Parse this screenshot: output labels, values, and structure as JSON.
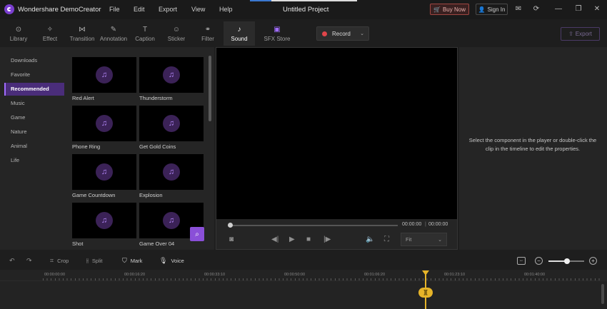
{
  "titlebar": {
    "app_name": "Wondershare DemoCreator",
    "menu": [
      "File",
      "Edit",
      "Export",
      "View",
      "Help"
    ],
    "project_title": "Untitled Project",
    "buy_now": "Buy Now",
    "sign_in": "Sign In"
  },
  "tabs": [
    {
      "label": "Library",
      "icon": "library-icon"
    },
    {
      "label": "Effect",
      "icon": "effect-icon"
    },
    {
      "label": "Transition",
      "icon": "transition-icon"
    },
    {
      "label": "Annotation",
      "icon": "annotation-icon"
    },
    {
      "label": "Caption",
      "icon": "caption-icon"
    },
    {
      "label": "Sticker",
      "icon": "sticker-icon"
    },
    {
      "label": "Filter",
      "icon": "filter-icon"
    },
    {
      "label": "Sound",
      "icon": "sound-icon"
    },
    {
      "label": "SFX Store",
      "icon": "sfx-store-icon"
    }
  ],
  "active_tab": "Sound",
  "record_label": "Record",
  "export_label": "Export",
  "categories": [
    "Downloads",
    "Favorite",
    "Recommended",
    "Music",
    "Game",
    "Nature",
    "Animal",
    "Life"
  ],
  "active_category": "Recommended",
  "sounds": [
    "Red Alert",
    "Thunderstorm",
    "Phone Ring",
    "Get Gold Coins",
    "Game Countdown",
    "Explosion",
    "Shot",
    "Game Over 04"
  ],
  "player": {
    "current_time": "00:00:00",
    "total_time": "00:00:00",
    "fit": "Fit"
  },
  "properties_message": "Select the component in the player or double-click the clip in the timeline to edit the properties.",
  "timeline_tools": {
    "crop": "Crop",
    "split": "Split",
    "mark": "Mark",
    "voice": "Voice"
  },
  "ruler_labels": [
    "00:00:00:00",
    "00:00:16:20",
    "00:00:33:10",
    "00:00:50:00",
    "00:01:06:20",
    "00:01:23:10",
    "00:01:40:00"
  ],
  "colors": {
    "accent": "#8a4fd8",
    "active_category_bg": "#4a2d7a",
    "playhead": "#e6b429",
    "record_dot": "#e0454a",
    "buy_now_border": "#a04642"
  }
}
